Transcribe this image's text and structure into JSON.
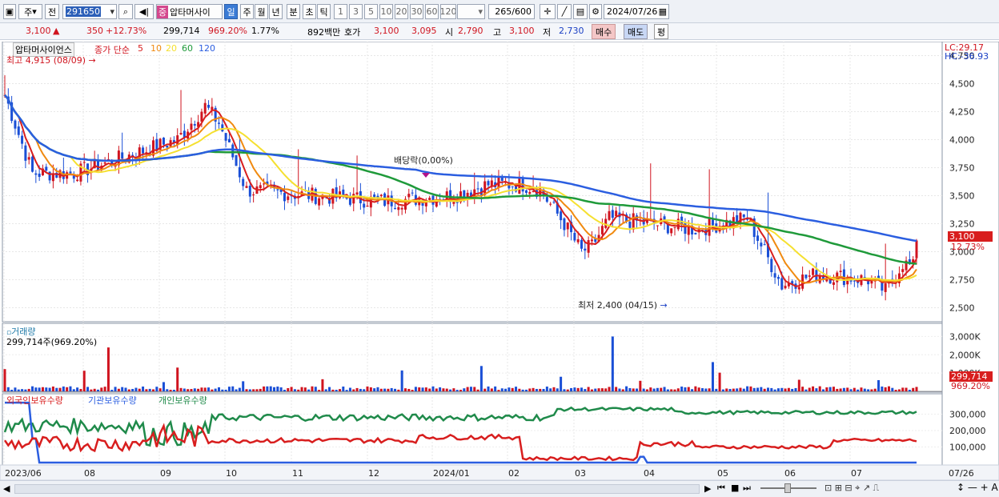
{
  "toolbar": {
    "period_label": "주",
    "prev_label": "전",
    "stock_code": "291650",
    "stock_badge": "중",
    "stock_name": "압타머사이",
    "timeframes": [
      "일",
      "주",
      "월",
      "년",
      "분",
      "초",
      "틱"
    ],
    "active_timeframe": "일",
    "intervals": [
      "1",
      "3",
      "5",
      "10",
      "20",
      "30",
      "60",
      "120"
    ],
    "candle_count": "265",
    "candle_total": "/600",
    "date": "2024/07/26"
  },
  "quote": {
    "price": "3,100",
    "change_arrow": "▲",
    "change": "350",
    "change_pct": "+12.73%",
    "volume": "299,714",
    "volume_ratio": "969.20%",
    "turnover": "1.77%",
    "trade_value": "892백만",
    "bid_label": "호가",
    "bid1": "3,100",
    "bid2": "3,095",
    "open_label": "시",
    "open": "2,790",
    "high_label": "고",
    "high": "3,100",
    "low_label": "저",
    "low": "2,730",
    "buy_label": "매수",
    "sell_label": "매도",
    "flat_label": "평"
  },
  "price_pane": {
    "title": "압타머사이언스",
    "legend_label": "종가 단순",
    "ma_periods": [
      "5",
      "10",
      "20",
      "60",
      "120"
    ],
    "ma_colors": [
      "#d81e1e",
      "#f08a10",
      "#f5e030",
      "#1f9a3a",
      "#2b5ee0"
    ],
    "high_marker": "최고 4,915 (08/09)",
    "low_marker": "최저 2,400 (04/15)",
    "dividend_marker": "배당락(0,00%)",
    "lc": "LC:29.17",
    "hc": "HC:-36.93",
    "y_ticks": [
      "4,750",
      "4,500",
      "4,250",
      "4,000",
      "3,750",
      "3,500",
      "3,250",
      "3,000",
      "2,750",
      "2,500"
    ],
    "last_price_tag": "3,100",
    "last_pct_tag": "12.73%"
  },
  "volume_pane": {
    "title": "거래량",
    "value": "299,714주(969.20%)",
    "y_ticks": [
      "3,000K",
      "2,000K",
      "1,000K"
    ],
    "last_tag": "299,714",
    "last_pct_tag": "969.20%"
  },
  "holding_pane": {
    "legend": [
      "외국인보유수량",
      "기관보유수량",
      "개인보유수량"
    ],
    "legend_colors": [
      "#d81e1e",
      "#2b5ee0",
      "#1f8a4a"
    ],
    "y_ticks": [
      "300,000",
      "200,000",
      "100,000"
    ]
  },
  "x_axis": {
    "labels": [
      "2023/06",
      "08",
      "09",
      "10",
      "11",
      "12",
      "2024/01",
      "02",
      "03",
      "04",
      "05",
      "06",
      "07"
    ],
    "end_label": "07/26"
  },
  "scroll": {
    "icons": [
      "play-icon",
      "first-icon",
      "last-icon",
      "stop-icon",
      "pause-icon"
    ],
    "tools": [
      "zoom-out-icon",
      "zoom-in-icon",
      "reset-icon"
    ]
  },
  "colors": {
    "up": "#d0141f",
    "down": "#1a4fd6",
    "ma120": "#2b5ee0",
    "ma60": "#1f9a3a"
  }
}
